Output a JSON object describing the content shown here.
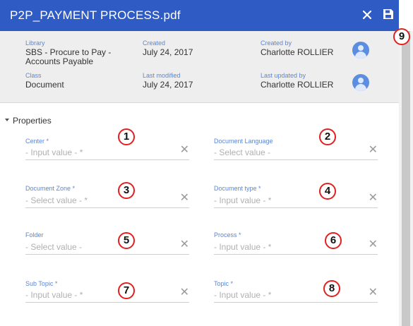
{
  "header": {
    "title": "P2P_PAYMENT PROCESS.pdf",
    "close_icon": "close-icon",
    "save_icon": "save-icon"
  },
  "metadata": {
    "library": {
      "label": "Library",
      "value": "SBS - Procure to Pay - Accounts Payable"
    },
    "created": {
      "label": "Created",
      "value": "July 24, 2017"
    },
    "created_by": {
      "label": "Created by",
      "value": "Charlotte ROLLIER"
    },
    "class": {
      "label": "Class",
      "value": "Document"
    },
    "last_modified": {
      "label": "Last modified",
      "value": "July 24, 2017"
    },
    "last_updated_by": {
      "label": "Last updated by",
      "value": "Charlotte ROLLIER"
    }
  },
  "properties": {
    "title": "Properties",
    "fields": [
      {
        "label": "Center *",
        "placeholder": "- Input value - *",
        "callout": "1"
      },
      {
        "label": "Document Language",
        "placeholder": "- Select value -",
        "callout": "2"
      },
      {
        "label": "Document Zone *",
        "placeholder": "- Select value - *",
        "callout": "3"
      },
      {
        "label": "Document type *",
        "placeholder": "- Input value - *",
        "callout": "4"
      },
      {
        "label": "Folder",
        "placeholder": "- Select value -",
        "callout": "5"
      },
      {
        "label": "Process *",
        "placeholder": "- Input value - *",
        "callout": "6"
      },
      {
        "label": "Sub Topic *",
        "placeholder": "- Input value - *",
        "callout": "7"
      },
      {
        "label": "Topic *",
        "placeholder": "- Input value - *",
        "callout": "8"
      }
    ],
    "clear_glyph": "✕"
  },
  "annotations": {
    "scrollbar_callout": "9"
  },
  "colors": {
    "header_bg": "#2f5bc4",
    "label_blue": "#5b86d6",
    "callout_red": "#e02020"
  }
}
